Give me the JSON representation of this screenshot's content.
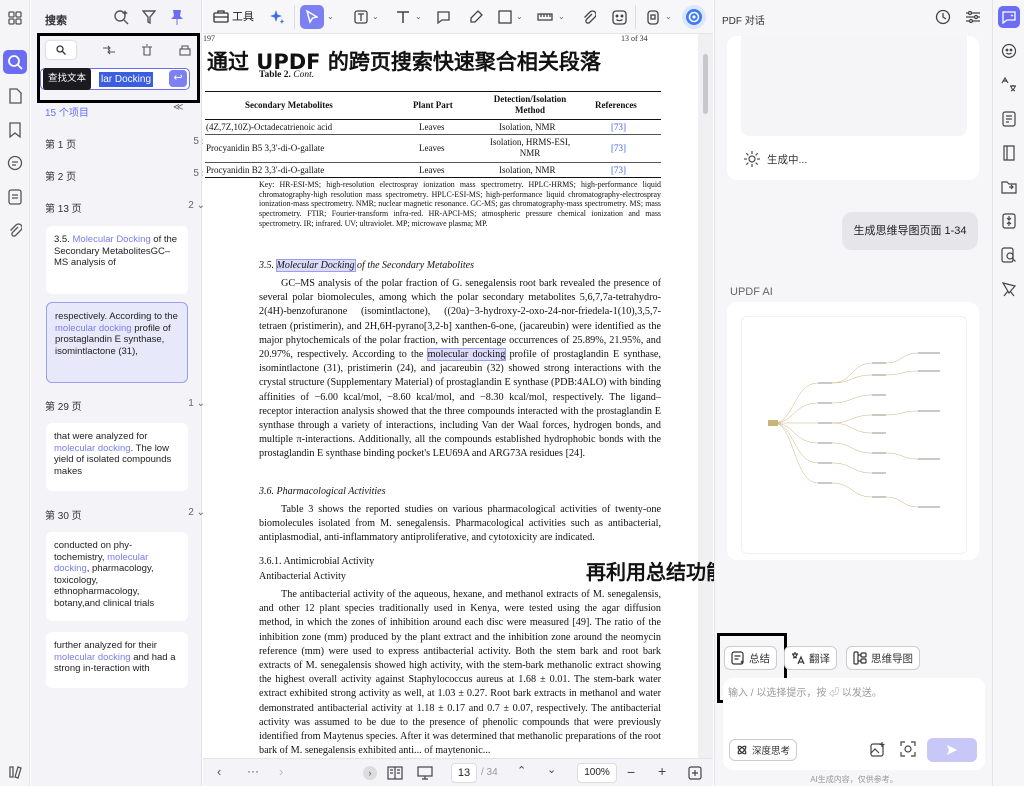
{
  "caption_top": "通过 UPDF 的跨页搜索快速聚合相关段落",
  "caption_bottom": "再利用总结功能梳理数据处理路径",
  "search_panel": {
    "title": "搜索",
    "tooltip": "查找文本",
    "query_visible": "lar Docking",
    "count": "15 个项目",
    "groups": [
      {
        "label": "第 1 页",
        "count": "5",
        "chev": "›"
      },
      {
        "label": "第 2 页",
        "count": "5",
        "chev": "›"
      },
      {
        "label": "第 13 页",
        "count": "2",
        "chev": "⌄"
      },
      {
        "label": "第 29 页",
        "count": "1",
        "chev": "⌄"
      },
      {
        "label": "第 30 页",
        "count": "2",
        "chev": "⌄"
      }
    ],
    "results": [
      {
        "pre": "3.5. ",
        "hit": "Molecular Docking",
        "post": " of the Secondary MetabolitesGC–MS analysis of"
      },
      {
        "pre": "respectively. According to the ",
        "hit": "molecular docking",
        "post": " profile of prostaglandin E synthase, isomintlactone (31),"
      },
      {
        "pre": "that were analyzed for ",
        "hit": "molecular docking",
        "post": ". The low yield of isolated compounds makes"
      },
      {
        "pre": "conducted on phy-tochemistry, ",
        "hit": "molecular docking",
        "post": ", pharmacology, toxicology, ethnopharmacology, botany,and clinical trials"
      },
      {
        "pre": "further analyzed for their ",
        "hit": "molecular docking",
        "post": " and had a strong in-teraction with"
      }
    ]
  },
  "toolbar": {
    "tools_label": "工具"
  },
  "document": {
    "page_left_num": "197",
    "page_right_num": "13 of 34",
    "table_caption_bold": "Table 2.",
    "table_caption_rest": " Cont.",
    "table_headers": [
      "Secondary Metabolites",
      "Plant Part",
      "Detection/Isolation Method",
      "References"
    ],
    "table_rows": [
      [
        "(4Z,7Z,10Z)-Octadecatrienoic acid",
        "Leaves",
        "Isolation, NMR",
        "[73]"
      ],
      [
        "Procyanidin B5 3,3′-di-O-gallate",
        "Leaves",
        "Isolation, HRMS-ESI, NMR",
        "[73]"
      ],
      [
        "Procyanidin B2 3,3′-di-O-gallate",
        "Leaves",
        "Isolation, NMR",
        "[73]"
      ]
    ],
    "table_key": "Key: HR-ESI-MS; high-resolution electrospray ionization mass spectrometry. HPLC-HRMS; high-performance liquid chromatography-high resolution mass spectrometry. HPLC-ESI-MS; high-performance liquid chromatography-electrospray ionization-mass spectrometry. NMR; nuclear magnetic resonance. GC-MS; gas chromatography-mass spectrometry. MS; mass spectrometry. FTIR; Fourier-transform infra-red. HR-APCI-MS; atmospheric pressure chemical ionization and mass spectrometry. IR; infrared. UV; ultraviolet. MP; microwave plasma; MP.",
    "sec35_num": "3.5. ",
    "sec35_hit": "Molecular Docking",
    "sec35_rest": " of the Secondary Metabolites",
    "p1_a": "GC–MS analysis of the polar fraction of G. senegalensis root bark revealed the presence of several polar biomolecules, among which the polar secondary metabolites 5,6,7,7a-tetrahydro-2(4H)-benzofuranone (isomintlactone), ((20a)−3-hydroxy-2-oxo-24-nor-friedela-1(10),3,5,7-tetraen (pristimerin), and 2H,6H-pyrano[3,2-b] xanthen-6-one, (jacareubin) were identified as the major phytochemicals of the polar fraction, with percentage occurrences of 25.89%, 21.95%, and 20.97%, respectively. According to the ",
    "p1_hit": "molecular docking",
    "p1_b": " profile of prostaglandin E synthase, isomintlactone (31), pristimerin (24), and jacareubin (32) showed strong interactions with the crystal structure (Supplementary Material) of prostaglandin E synthase (PDB:4ALO) with binding affinities of −6.00 kcal/mol, −8.60 kcal/mol, and −8.30 kcal/mol, respectively. The ligand–receptor interaction analysis showed that the three compounds interacted with the prostaglandin E synthase through a variety of interactions, including Van der Waal forces, hydrogen bonds, and multiple π-interactions. Additionally, all the compounds established hydrophobic bonds with the prostaglandin E synthase binding pocket's LEU69A and ARG73A residues [24].",
    "sec36": "3.6. Pharmacological Activities",
    "p2": "Table 3 shows the reported studies on various pharmacological activities of twenty-one biomolecules isolated from M. senegalensis. Pharmacological activities such as antibacterial, antiplasmodial, anti-inflammatory antiproliferative, and cytotoxicity are indicated.",
    "sec361": "3.6.1. Antimicrobial Activity",
    "sec361_sub": "Antibacterial Activity",
    "p3": "The antibacterial activity of the aqueous, hexane, and methanol extracts of M. senegalensis, and other 12 plant species traditionally used in Kenya, were tested using the agar diffusion method, in which the zones of inhibition around each disc were measured [49]. The ratio of the inhibition zone (mm) produced by the plant extract and the inhibition zone around the neomycin reference (mm) were used to express antibacterial activity. Both the stem bark and root bark extracts of M. senegalensis showed high activity, with the stem-bark methanolic extract showing the highest overall activity against Staphylococcus aureus at 1.68 ± 0.01. The stem-bark water extract exhibited strong activity as well, at 1.03 ± 0.27. Root bark extracts in methanol and water demonstrated antibacterial activity at 1.18 ± 0.17 and 0.7 ± 0.07, respectively. The antibacterial activity was assumed to be due to the presence of phenolic compounds that were previously identified from Maytenus species. After it was determined that methanolic preparations of the root bark of M. senegalensis exhibited anti... of maytenonic..."
  },
  "bottombar": {
    "page_current": "13",
    "page_total": "/ 34",
    "zoom": "100%"
  },
  "chat": {
    "title": "PDF 对话",
    "generating": "生成中...",
    "user_msg": "生成思维导图页面 1-34",
    "ai_label": "UPDF AI",
    "chips": [
      "总结",
      "翻译",
      "思维导图"
    ],
    "input_placeholder": "输入 / 以选择提示，按 ⏎ 以发送。",
    "deep_think": "深度思考",
    "disclaimer": "AI生成内容，仅供参考。"
  }
}
